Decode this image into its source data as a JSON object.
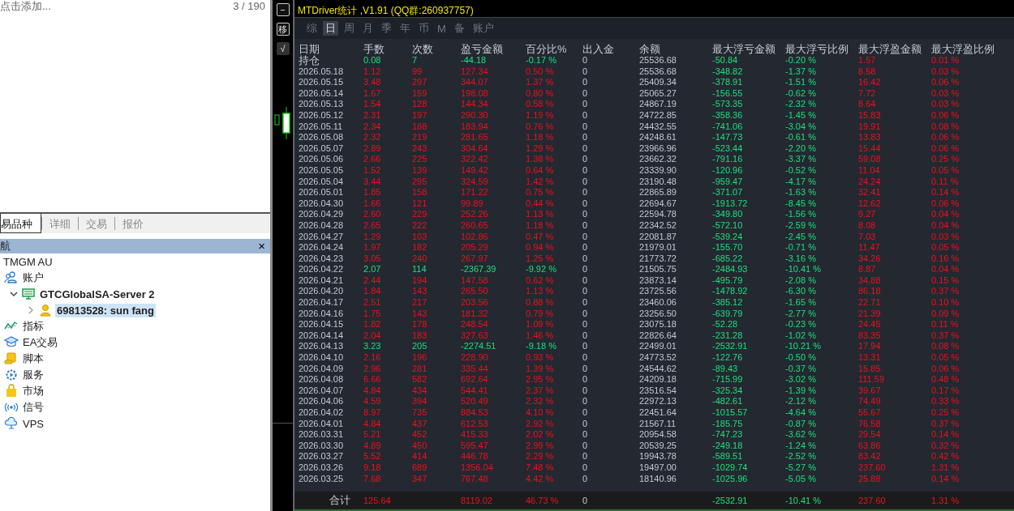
{
  "left_panel": {
    "symbols_hint": "点击添加...",
    "symbols_count": "3 / 190",
    "tabs": [
      {
        "label": "易品种",
        "selected": true
      },
      {
        "label": "详细",
        "selected": false
      },
      {
        "label": "交易",
        "selected": false
      },
      {
        "label": "报价",
        "selected": false
      }
    ],
    "navigator": {
      "title": "航",
      "close": "×",
      "broker": "TMGM AU",
      "tree": [
        {
          "label": "账户",
          "selected": false,
          "children": [
            {
              "label": "GTCGlobalSA-Server 2",
              "selected": false,
              "expanded": true,
              "children": [
                {
                  "label": "69813528: sun fang",
                  "selected": true,
                  "expanded": false
                }
              ]
            }
          ]
        },
        {
          "label": "指标",
          "selected": false
        },
        {
          "label": "EA交易",
          "selected": false
        },
        {
          "label": "脚本",
          "selected": false
        },
        {
          "label": "服务",
          "selected": false
        },
        {
          "label": "市场",
          "selected": false
        },
        {
          "label": "信号",
          "selected": false
        },
        {
          "label": "VPS",
          "selected": false
        }
      ]
    }
  },
  "side_toolbar": {
    "buttons": [
      "−",
      "移",
      "√"
    ]
  },
  "report": {
    "title": "MTDriver统计 ,V1.91 (QQ群:260937757)",
    "tabs": [
      {
        "label": "综",
        "selected": false
      },
      {
        "label": "日",
        "selected": true
      },
      {
        "label": "周",
        "selected": false
      },
      {
        "label": "月",
        "selected": false
      },
      {
        "label": "季",
        "selected": false
      },
      {
        "label": "年",
        "selected": false
      },
      {
        "label": "币",
        "selected": false
      },
      {
        "label": "M",
        "selected": false
      },
      {
        "label": "备",
        "selected": false
      },
      {
        "label": "账户",
        "selected": false
      }
    ],
    "columns": [
      "日期",
      "手数",
      "次数",
      "盈亏金额",
      "百分比%",
      "出入金",
      "余额",
      "最大浮亏金额",
      "最大浮亏比例",
      "最大浮盈金额",
      "最大浮盈比例"
    ],
    "rows": [
      {
        "kind": "loss",
        "cells": [
          "持仓",
          "0.08",
          "7",
          "-44.18",
          "-0.17 %",
          "0",
          "25536.68",
          "-50.84",
          "-0.20 %",
          "1.57",
          "0.01 %"
        ]
      },
      {
        "kind": "profit",
        "cells": [
          "2026.05.18",
          "1.12",
          "99",
          "127.34",
          "0.50 %",
          "0",
          "25536.68",
          "-348.82",
          "-1.37 %",
          "8.58",
          "0.03 %"
        ]
      },
      {
        "kind": "profit",
        "cells": [
          "2026.05.15",
          "3.48",
          "297",
          "344.07",
          "1.37 %",
          "0",
          "25409.34",
          "-378.91",
          "-1.51 %",
          "16.42",
          "0.06 %"
        ]
      },
      {
        "kind": "profit",
        "cells": [
          "2026.05.14",
          "1.67",
          "159",
          "198.08",
          "0.80 %",
          "0",
          "25065.27",
          "-156.55",
          "-0.62 %",
          "7.72",
          "0.03 %"
        ]
      },
      {
        "kind": "profit",
        "cells": [
          "2026.05.13",
          "1.54",
          "128",
          "144.34",
          "0.58 %",
          "0",
          "24867.19",
          "-573.35",
          "-2.32 %",
          "8.64",
          "0.03 %"
        ]
      },
      {
        "kind": "profit",
        "cells": [
          "2026.05.12",
          "2.31",
          "197",
          "290.30",
          "1.19 %",
          "0",
          "24722.85",
          "-358.36",
          "-1.45 %",
          "15.83",
          "0.06 %"
        ]
      },
      {
        "kind": "profit",
        "cells": [
          "2026.05.11",
          "2.34",
          "188",
          "183.94",
          "0.76 %",
          "0",
          "24432.55",
          "-741.06",
          "-3.04 %",
          "19.91",
          "0.08 %"
        ]
      },
      {
        "kind": "profit",
        "cells": [
          "2026.05.08",
          "2.32",
          "219",
          "281.65",
          "1.18 %",
          "0",
          "24248.61",
          "-147.73",
          "-0.61 %",
          "13.83",
          "0.06 %"
        ]
      },
      {
        "kind": "profit",
        "cells": [
          "2026.05.07",
          "2.89",
          "243",
          "304.64",
          "1.29 %",
          "0",
          "23966.96",
          "-523.44",
          "-2.20 %",
          "15.44",
          "0.06 %"
        ]
      },
      {
        "kind": "profit",
        "cells": [
          "2026.05.06",
          "2.66",
          "225",
          "322.42",
          "1.38 %",
          "0",
          "23662.32",
          "-791.16",
          "-3.37 %",
          "59.08",
          "0.25 %"
        ]
      },
      {
        "kind": "profit",
        "cells": [
          "2026.05.05",
          "1.52",
          "139",
          "149.42",
          "0.64 %",
          "0",
          "23339.90",
          "-120.96",
          "-0.52 %",
          "11.04",
          "0.05 %"
        ]
      },
      {
        "kind": "profit",
        "cells": [
          "2026.05.04",
          "3.44",
          "295",
          "324.59",
          "1.42 %",
          "0",
          "23190.48",
          "-959.47",
          "-4.17 %",
          "24.24",
          "0.11 %"
        ]
      },
      {
        "kind": "profit",
        "cells": [
          "2026.05.01",
          "1.85",
          "158",
          "171.22",
          "0.75 %",
          "0",
          "22865.89",
          "-371.07",
          "-1.63 %",
          "32.41",
          "0.14 %"
        ]
      },
      {
        "kind": "profit",
        "cells": [
          "2026.04.30",
          "1.66",
          "121",
          "99.89",
          "0.44 %",
          "0",
          "22694.67",
          "-1913.72",
          "-8.45 %",
          "12.62",
          "0.06 %"
        ]
      },
      {
        "kind": "profit",
        "cells": [
          "2026.04.29",
          "2.60",
          "229",
          "252.26",
          "1.13 %",
          "0",
          "22594.78",
          "-349.80",
          "-1.56 %",
          "9.27",
          "0.04 %"
        ]
      },
      {
        "kind": "profit",
        "cells": [
          "2026.04.28",
          "2.65",
          "222",
          "260.65",
          "1.18 %",
          "0",
          "22342.52",
          "-572.10",
          "-2.59 %",
          "8.08",
          "0.04 %"
        ]
      },
      {
        "kind": "profit",
        "cells": [
          "2026.04.27",
          "1.29",
          "103",
          "102.86",
          "0.47 %",
          "0",
          "22081.87",
          "-539.24",
          "-2.45 %",
          "7.03",
          "0.03 %"
        ]
      },
      {
        "kind": "profit",
        "cells": [
          "2026.04.24",
          "1.97",
          "182",
          "205.29",
          "0.94 %",
          "0",
          "21979.01",
          "-155.70",
          "-0.71 %",
          "11.47",
          "0.05 %"
        ]
      },
      {
        "kind": "profit",
        "cells": [
          "2026.04.23",
          "3.05",
          "240",
          "267.97",
          "1.25 %",
          "0",
          "21773.72",
          "-685.22",
          "-3.16 %",
          "34.26",
          "0.16 %"
        ]
      },
      {
        "kind": "loss",
        "cells": [
          "2026.04.22",
          "2.07",
          "114",
          "-2367.39",
          "-9.92 %",
          "0",
          "21505.75",
          "-2484.93",
          "-10.41 %",
          "8.87",
          "0.04 %"
        ]
      },
      {
        "kind": "profit",
        "cells": [
          "2026.04.21",
          "2.44",
          "194",
          "147.58",
          "0.62 %",
          "0",
          "23873.14",
          "-495.79",
          "-2.08 %",
          "34.88",
          "0.15 %"
        ]
      },
      {
        "kind": "profit",
        "cells": [
          "2026.04.20",
          "1.84",
          "143",
          "265.50",
          "1.13 %",
          "0",
          "23725.56",
          "-1478.92",
          "-6.30 %",
          "86.18",
          "0.37 %"
        ]
      },
      {
        "kind": "profit",
        "cells": [
          "2026.04.17",
          "2.51",
          "217",
          "203.56",
          "0.88 %",
          "0",
          "23460.06",
          "-385.12",
          "-1.65 %",
          "22.71",
          "0.10 %"
        ]
      },
      {
        "kind": "profit",
        "cells": [
          "2026.04.16",
          "1.75",
          "143",
          "181.32",
          "0.79 %",
          "0",
          "23256.50",
          "-639.79",
          "-2.77 %",
          "21.39",
          "0.09 %"
        ]
      },
      {
        "kind": "profit",
        "cells": [
          "2026.04.15",
          "1.82",
          "178",
          "248.54",
          "1.09 %",
          "0",
          "23075.18",
          "-52.28",
          "-0.23 %",
          "24.45",
          "0.11 %"
        ]
      },
      {
        "kind": "profit",
        "cells": [
          "2026.04.14",
          "2.04",
          "183",
          "327.63",
          "1.46 %",
          "0",
          "22826.64",
          "-231.28",
          "-1.02 %",
          "83.35",
          "0.37 %"
        ]
      },
      {
        "kind": "loss",
        "cells": [
          "2026.04.13",
          "3.23",
          "205",
          "-2274.51",
          "-9.18 %",
          "0",
          "22499.01",
          "-2532.91",
          "-10.21 %",
          "17.94",
          "0.08 %"
        ]
      },
      {
        "kind": "profit",
        "cells": [
          "2026.04.10",
          "2.16",
          "196",
          "228.90",
          "0.93 %",
          "0",
          "24773.52",
          "-122.76",
          "-0.50 %",
          "13.31",
          "0.05 %"
        ]
      },
      {
        "kind": "profit",
        "cells": [
          "2026.04.09",
          "2.96",
          "281",
          "335.44",
          "1.39 %",
          "0",
          "24544.62",
          "-89.43",
          "-0.37 %",
          "15.85",
          "0.06 %"
        ]
      },
      {
        "kind": "profit",
        "cells": [
          "2026.04.08",
          "6.66",
          "582",
          "692.64",
          "2.95 %",
          "0",
          "24209.18",
          "-715.99",
          "-3.02 %",
          "111.59",
          "0.48 %"
        ]
      },
      {
        "kind": "profit",
        "cells": [
          "2026.04.07",
          "4.84",
          "434",
          "544.41",
          "2.37 %",
          "0",
          "23516.54",
          "-325.34",
          "-1.39 %",
          "39.67",
          "0.17 %"
        ]
      },
      {
        "kind": "profit",
        "cells": [
          "2026.04.06",
          "4.59",
          "394",
          "520.49",
          "2.32 %",
          "0",
          "22972.13",
          "-482.61",
          "-2.12 %",
          "74.49",
          "0.33 %"
        ]
      },
      {
        "kind": "profit",
        "cells": [
          "2026.04.02",
          "8.97",
          "735",
          "884.53",
          "4.10 %",
          "0",
          "22451.64",
          "-1015.57",
          "-4.64 %",
          "55.67",
          "0.25 %"
        ]
      },
      {
        "kind": "profit",
        "cells": [
          "2026.04.01",
          "4.84",
          "437",
          "612.53",
          "2.92 %",
          "0",
          "21567.11",
          "-185.75",
          "-0.87 %",
          "76.58",
          "0.37 %"
        ]
      },
      {
        "kind": "profit",
        "cells": [
          "2026.03.31",
          "5.21",
          "452",
          "415.33",
          "2.02 %",
          "0",
          "20954.58",
          "-747.23",
          "-3.62 %",
          "29.54",
          "0.14 %"
        ]
      },
      {
        "kind": "profit",
        "cells": [
          "2026.03.30",
          "4.89",
          "450",
          "595.47",
          "2.99 %",
          "0",
          "20539.25",
          "-249.18",
          "-1.24 %",
          "63.86",
          "0.32 %"
        ]
      },
      {
        "kind": "profit",
        "cells": [
          "2026.03.27",
          "5.52",
          "414",
          "446.78",
          "2.29 %",
          "0",
          "19943.78",
          "-589.51",
          "-2.52 %",
          "83.42",
          "0.42 %"
        ]
      },
      {
        "kind": "profit",
        "cells": [
          "2026.03.26",
          "9.18",
          "689",
          "1356.04",
          "7.48 %",
          "0",
          "19497.00",
          "-1029.74",
          "-5.27 %",
          "237.60",
          "1.31 %"
        ]
      },
      {
        "kind": "profit",
        "cells": [
          "2026.03.25",
          "7.68",
          "347",
          "767.48",
          "4.42 %",
          "0",
          "18140.96",
          "-1025.96",
          "-5.05 %",
          "25.88",
          "0.14 %"
        ]
      }
    ],
    "total": {
      "label": "合计",
      "lots": "125.64",
      "profit": "8119.02",
      "percent": "46.73 %",
      "deposit": "0",
      "max_float_loss": "-2532.91",
      "max_float_loss_pct": "-10.41 %",
      "max_float_profit": "237.60",
      "max_float_profit_pct": "1.31 %"
    }
  }
}
